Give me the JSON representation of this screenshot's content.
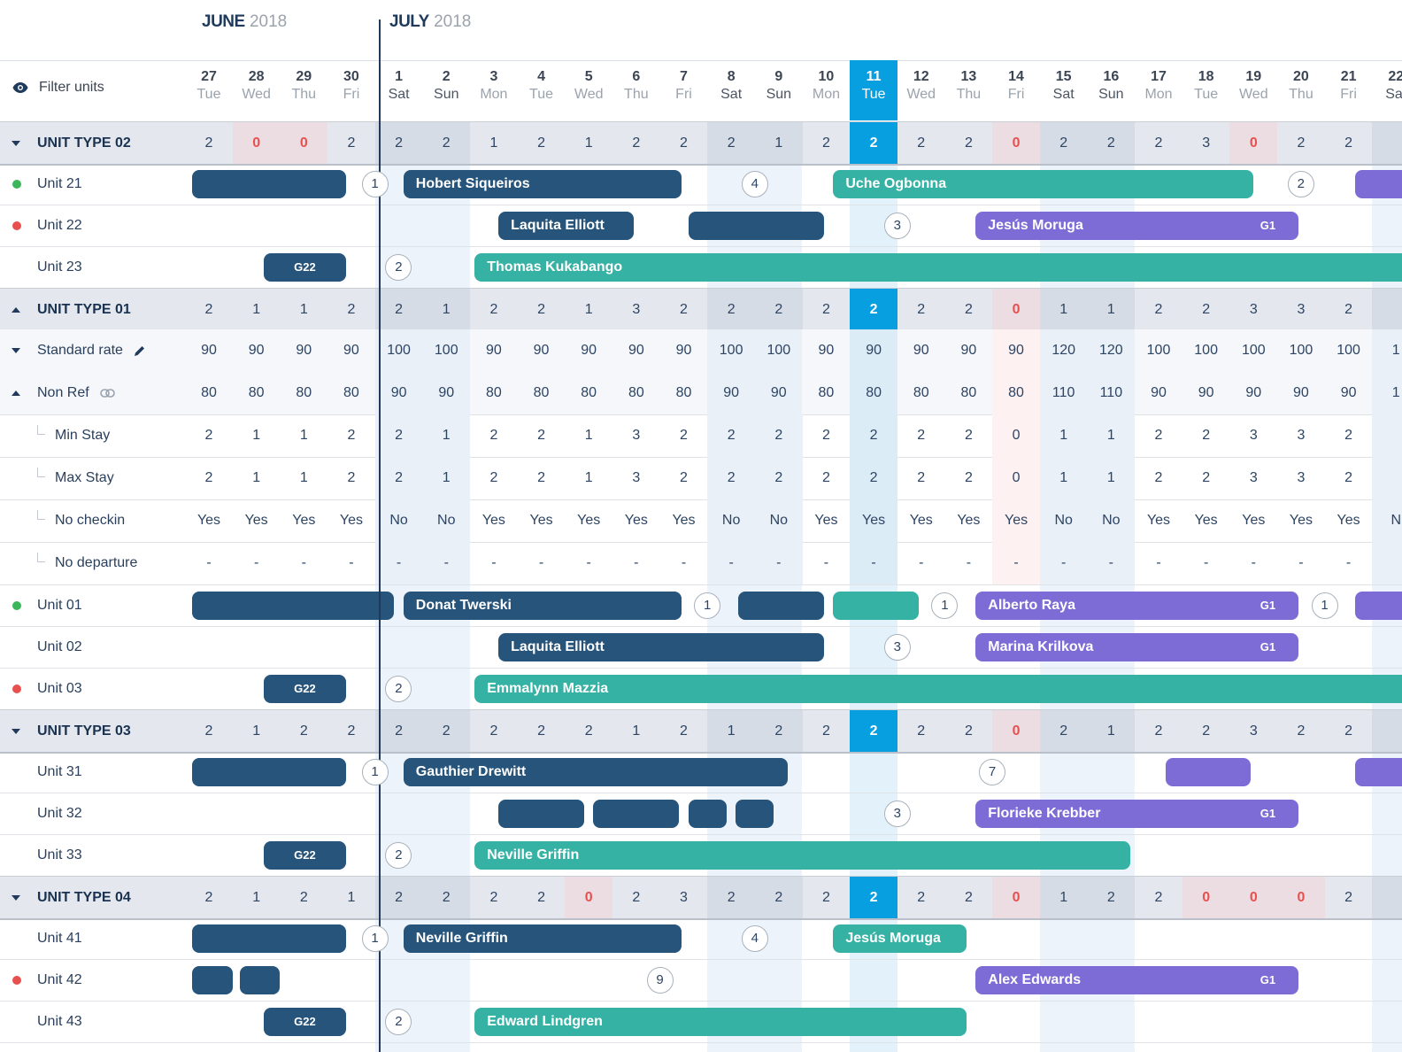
{
  "header": {
    "months": [
      {
        "name": "JUNE",
        "year": "2018"
      },
      {
        "name": "JULY",
        "year": "2018"
      }
    ],
    "filter_label": "Filter units",
    "filter_icon": "eye-icon"
  },
  "days": [
    {
      "num": "27",
      "dow": "Tue"
    },
    {
      "num": "28",
      "dow": "Wed"
    },
    {
      "num": "29",
      "dow": "Thu"
    },
    {
      "num": "30",
      "dow": "Fri"
    },
    {
      "num": "1",
      "dow": "Sat"
    },
    {
      "num": "2",
      "dow": "Sun"
    },
    {
      "num": "3",
      "dow": "Mon"
    },
    {
      "num": "4",
      "dow": "Tue"
    },
    {
      "num": "5",
      "dow": "Wed"
    },
    {
      "num": "6",
      "dow": "Thu"
    },
    {
      "num": "7",
      "dow": "Fri"
    },
    {
      "num": "8",
      "dow": "Sat"
    },
    {
      "num": "9",
      "dow": "Sun"
    },
    {
      "num": "10",
      "dow": "Mon"
    },
    {
      "num": "11",
      "dow": "Tue"
    },
    {
      "num": "12",
      "dow": "Wed"
    },
    {
      "num": "13",
      "dow": "Thu"
    },
    {
      "num": "14",
      "dow": "Fri"
    },
    {
      "num": "15",
      "dow": "Sat"
    },
    {
      "num": "16",
      "dow": "Sun"
    },
    {
      "num": "17",
      "dow": "Mon"
    },
    {
      "num": "18",
      "dow": "Tue"
    },
    {
      "num": "19",
      "dow": "Wed"
    },
    {
      "num": "20",
      "dow": "Thu"
    },
    {
      "num": "21",
      "dow": "Fri"
    },
    {
      "num": "22",
      "dow": "Sat"
    }
  ],
  "selected_day_index": 14,
  "weekend_indices": [
    4,
    5,
    11,
    12,
    18,
    19,
    25
  ],
  "colors": {
    "today": "#089fe0",
    "navy": "#27547b",
    "teal": "#36b2a5",
    "purple": "#7d6cd5",
    "red": "#e8504f",
    "green": "#3cb65a"
  },
  "rows": [
    {
      "kind": "type",
      "label": "UNIT TYPE 02",
      "caret": "down",
      "values": [
        "2",
        "0",
        "0",
        "2",
        "2",
        "2",
        "1",
        "2",
        "1",
        "2",
        "2",
        "2",
        "1",
        "2",
        "2",
        "2",
        "2",
        "0",
        "2",
        "2",
        "2",
        "3",
        "0",
        "2",
        "2",
        ""
      ]
    },
    {
      "kind": "unit",
      "label": "Unit 21",
      "status": "green",
      "bookings": [
        {
          "from": -0.35,
          "to": 2.9,
          "color": "navy",
          "name": ""
        },
        {
          "from": 4.1,
          "to": 9.95,
          "color": "navy",
          "name": "Hobert Siqueiros"
        },
        {
          "from": 13.15,
          "to": 22.0,
          "color": "teal",
          "name": "Uche Ogbonna"
        },
        {
          "from": 24.15,
          "to": 26.5,
          "color": "purple",
          "name": ""
        }
      ],
      "gaps": [
        {
          "at": 3.5,
          "n": "1"
        },
        {
          "at": 11.5,
          "n": "4"
        },
        {
          "at": 23.0,
          "n": "2"
        }
      ]
    },
    {
      "kind": "unit",
      "label": "Unit 22",
      "status": "red",
      "bookings": [
        {
          "from": 6.1,
          "to": 8.95,
          "color": "navy",
          "name": "Laquita Elliott"
        },
        {
          "from": 10.1,
          "to": 12.95,
          "color": "navy",
          "name": ""
        },
        {
          "from": 16.15,
          "to": 22.95,
          "color": "purple",
          "name": "Jesús Moruga",
          "tag": "G1"
        }
      ],
      "gaps": [
        {
          "at": 14.5,
          "n": "3"
        }
      ]
    },
    {
      "kind": "unit",
      "label": "Unit 23",
      "status": "",
      "bookings": [
        {
          "from": 1.15,
          "to": 2.9,
          "color": "navy",
          "name": "",
          "tag_center": "G22"
        },
        {
          "from": 5.6,
          "to": 26.5,
          "color": "teal",
          "name": "Thomas Kukabango"
        }
      ],
      "gaps": [
        {
          "at": 4.0,
          "n": "2"
        }
      ]
    },
    {
      "kind": "type",
      "label": "UNIT TYPE 01",
      "caret": "up",
      "values": [
        "2",
        "1",
        "1",
        "2",
        "2",
        "1",
        "2",
        "2",
        "1",
        "3",
        "2",
        "2",
        "2",
        "2",
        "2",
        "2",
        "2",
        "0",
        "1",
        "1",
        "2",
        "2",
        "3",
        "3",
        "2",
        ""
      ]
    },
    {
      "kind": "rate",
      "label": "Standard rate",
      "caret": "down",
      "icon": "pencil-icon",
      "values": [
        "90",
        "90",
        "90",
        "90",
        "100",
        "100",
        "90",
        "90",
        "90",
        "90",
        "90",
        "100",
        "100",
        "90",
        "90",
        "90",
        "90",
        "90",
        "120",
        "120",
        "100",
        "100",
        "100",
        "100",
        "100",
        "1"
      ]
    },
    {
      "kind": "rate",
      "label": "Non Ref",
      "caret": "up",
      "icon": "link-icon",
      "values": [
        "80",
        "80",
        "80",
        "80",
        "90",
        "90",
        "80",
        "80",
        "80",
        "80",
        "80",
        "90",
        "90",
        "80",
        "80",
        "80",
        "80",
        "80",
        "110",
        "110",
        "90",
        "90",
        "90",
        "90",
        "90",
        "1"
      ]
    },
    {
      "kind": "restriction",
      "label": "Min Stay",
      "values": [
        "2",
        "1",
        "1",
        "2",
        "2",
        "1",
        "2",
        "2",
        "1",
        "3",
        "2",
        "2",
        "2",
        "2",
        "2",
        "2",
        "2",
        "0",
        "1",
        "1",
        "2",
        "2",
        "3",
        "3",
        "2",
        ""
      ]
    },
    {
      "kind": "restriction",
      "label": "Max Stay",
      "values": [
        "2",
        "1",
        "1",
        "2",
        "2",
        "1",
        "2",
        "2",
        "1",
        "3",
        "2",
        "2",
        "2",
        "2",
        "2",
        "2",
        "2",
        "0",
        "1",
        "1",
        "2",
        "2",
        "3",
        "3",
        "2",
        ""
      ]
    },
    {
      "kind": "restriction",
      "label": "No checkin",
      "values": [
        "Yes",
        "Yes",
        "Yes",
        "Yes",
        "No",
        "No",
        "Yes",
        "Yes",
        "Yes",
        "Yes",
        "Yes",
        "No",
        "No",
        "Yes",
        "Yes",
        "Yes",
        "Yes",
        "Yes",
        "No",
        "No",
        "Yes",
        "Yes",
        "Yes",
        "Yes",
        "Yes",
        "N"
      ]
    },
    {
      "kind": "restriction",
      "label": "No departure",
      "values": [
        "-",
        "-",
        "-",
        "-",
        "-",
        "-",
        "-",
        "-",
        "-",
        "-",
        "-",
        "-",
        "-",
        "-",
        "-",
        "-",
        "-",
        "-",
        "-",
        "-",
        "-",
        "-",
        "-",
        "-",
        "-",
        ""
      ]
    },
    {
      "kind": "unit",
      "label": "Unit 01",
      "status": "green",
      "bookings": [
        {
          "from": -0.35,
          "to": 3.9,
          "color": "navy",
          "name": ""
        },
        {
          "from": 4.1,
          "to": 9.95,
          "color": "navy",
          "name": "Donat Twerski"
        },
        {
          "from": 11.15,
          "to": 12.95,
          "color": "navy",
          "name": ""
        },
        {
          "from": 13.15,
          "to": 14.95,
          "color": "teal",
          "name": ""
        },
        {
          "from": 16.15,
          "to": 22.95,
          "color": "purple",
          "name": "Alberto Raya",
          "tag": "G1"
        },
        {
          "from": 24.15,
          "to": 26.5,
          "color": "purple",
          "name": ""
        }
      ],
      "gaps": [
        {
          "at": 10.5,
          "n": "1"
        },
        {
          "at": 15.5,
          "n": "1"
        },
        {
          "at": 23.5,
          "n": "1"
        }
      ]
    },
    {
      "kind": "unit",
      "label": "Unit 02",
      "status": "",
      "bookings": [
        {
          "from": 6.1,
          "to": 12.95,
          "color": "navy",
          "name": "Laquita Elliott"
        },
        {
          "from": 16.15,
          "to": 22.95,
          "color": "purple",
          "name": "Marina Krilkova",
          "tag": "G1"
        }
      ],
      "gaps": [
        {
          "at": 14.5,
          "n": "3"
        }
      ]
    },
    {
      "kind": "unit",
      "label": "Unit 03",
      "status": "red",
      "bookings": [
        {
          "from": 1.15,
          "to": 2.9,
          "color": "navy",
          "name": "",
          "tag_center": "G22"
        },
        {
          "from": 5.6,
          "to": 26.5,
          "color": "teal",
          "name": "Emmalynn Mazzia"
        }
      ],
      "gaps": [
        {
          "at": 4.0,
          "n": "2"
        }
      ]
    },
    {
      "kind": "type",
      "label": "UNIT TYPE 03",
      "caret": "down",
      "values": [
        "2",
        "1",
        "2",
        "2",
        "2",
        "2",
        "2",
        "2",
        "2",
        "1",
        "2",
        "1",
        "2",
        "2",
        "2",
        "2",
        "2",
        "0",
        "2",
        "1",
        "2",
        "2",
        "3",
        "2",
        "2",
        ""
      ]
    },
    {
      "kind": "unit",
      "label": "Unit 31",
      "status": "",
      "bookings": [
        {
          "from": -0.35,
          "to": 2.9,
          "color": "navy",
          "name": ""
        },
        {
          "from": 4.1,
          "to": 12.2,
          "color": "navy",
          "name": "Gauthier Drewitt"
        },
        {
          "from": 20.15,
          "to": 21.95,
          "color": "purple",
          "name": ""
        },
        {
          "from": 24.15,
          "to": 26.5,
          "color": "purple",
          "name": ""
        }
      ],
      "gaps": [
        {
          "at": 3.5,
          "n": "1"
        },
        {
          "at": 16.5,
          "n": "7"
        }
      ]
    },
    {
      "kind": "unit",
      "label": "Unit 32",
      "status": "",
      "bookings": [
        {
          "from": 6.1,
          "to": 7.9,
          "color": "navy",
          "name": ""
        },
        {
          "from": 8.1,
          "to": 9.9,
          "color": "navy",
          "name": ""
        },
        {
          "from": 10.1,
          "to": 10.9,
          "color": "navy",
          "name": ""
        },
        {
          "from": 11.1,
          "to": 11.9,
          "color": "navy",
          "name": ""
        },
        {
          "from": 16.15,
          "to": 22.95,
          "color": "purple",
          "name": "Florieke Krebber",
          "tag": "G1"
        }
      ],
      "gaps": [
        {
          "at": 14.5,
          "n": "3"
        }
      ]
    },
    {
      "kind": "unit",
      "label": "Unit 33",
      "status": "",
      "bookings": [
        {
          "from": 1.15,
          "to": 2.9,
          "color": "navy",
          "name": "",
          "tag_center": "G22"
        },
        {
          "from": 5.6,
          "to": 19.4,
          "color": "teal",
          "name": "Neville Griffin"
        }
      ],
      "gaps": [
        {
          "at": 4.0,
          "n": "2"
        }
      ]
    },
    {
      "kind": "type",
      "label": "UNIT TYPE 04",
      "caret": "down",
      "values": [
        "2",
        "1",
        "2",
        "1",
        "2",
        "2",
        "2",
        "2",
        "0",
        "2",
        "3",
        "2",
        "2",
        "2",
        "2",
        "2",
        "2",
        "0",
        "1",
        "2",
        "2",
        "0",
        "0",
        "0",
        "2",
        ""
      ]
    },
    {
      "kind": "unit",
      "label": "Unit 41",
      "status": "",
      "bookings": [
        {
          "from": -0.35,
          "to": 2.9,
          "color": "navy",
          "name": ""
        },
        {
          "from": 4.1,
          "to": 9.95,
          "color": "navy",
          "name": "Neville Griffin"
        },
        {
          "from": 13.15,
          "to": 15.95,
          "color": "teal",
          "name": "Jesús Moruga"
        }
      ],
      "gaps": [
        {
          "at": 3.5,
          "n": "1"
        },
        {
          "at": 11.5,
          "n": "4"
        }
      ]
    },
    {
      "kind": "unit",
      "label": "Unit 42",
      "status": "red",
      "bookings": [
        {
          "from": -0.35,
          "to": 0.5,
          "color": "navy",
          "name": ""
        },
        {
          "from": 0.65,
          "to": 1.5,
          "color": "navy",
          "name": ""
        },
        {
          "from": 16.15,
          "to": 22.95,
          "color": "purple",
          "name": "Alex Edwards",
          "tag": "G1"
        }
      ],
      "gaps": [
        {
          "at": 9.5,
          "n": "9"
        }
      ]
    },
    {
      "kind": "unit",
      "label": "Unit 43",
      "status": "",
      "bookings": [
        {
          "from": 1.15,
          "to": 2.9,
          "color": "navy",
          "name": "",
          "tag_center": "G22"
        },
        {
          "from": 5.6,
          "to": 15.95,
          "color": "teal",
          "name": "Edward Lindgren"
        }
      ],
      "gaps": [
        {
          "at": 4.0,
          "n": "2"
        }
      ]
    }
  ]
}
